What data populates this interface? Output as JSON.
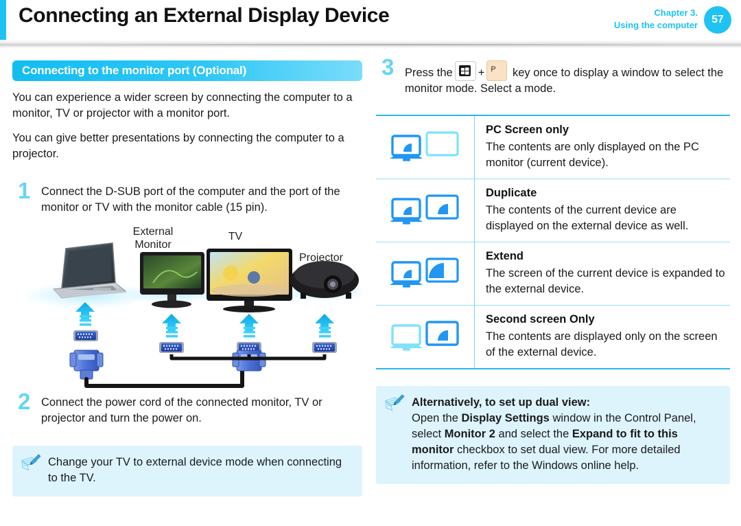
{
  "header": {
    "title": "Connecting an External Display Device",
    "chapter_line1": "Chapter 3.",
    "chapter_line2": "Using the computer",
    "page_number": "57",
    "accent_color": "#1ec2f3"
  },
  "left": {
    "section_title": "Connecting to the monitor port (Optional)",
    "paragraph1": "You can experience a wider screen by connecting the computer to a monitor, TV or projector with a monitor port.",
    "paragraph2": "You can give better presentations by connecting the computer to a projector.",
    "step1_number": "1",
    "step1_text": "Connect the D-SUB port of the computer and the port of the monitor or TV with the monitor cable (15 pin).",
    "step2_number": "2",
    "step2_text": "Connect the power cord of the connected monitor, TV or projector and turn the power on.",
    "note_text": "Change your TV to external device mode when connecting to the TV.",
    "diagram": {
      "label_external_monitor_line1": "External",
      "label_external_monitor_line2": "Monitor",
      "label_tv": "TV",
      "label_projector": "Projector"
    }
  },
  "right": {
    "step3_number": "3",
    "step3_text_before": "Press the",
    "key_windows": "windows-key-icon",
    "key_plus": "+",
    "key_p": "P",
    "step3_text_after": "key once to display a window to select the monitor mode. Select a mode.",
    "modes": [
      {
        "icon": "pc-screen-only-icon",
        "title": "PC Screen only",
        "desc": "The contents are only displayed on the PC monitor (current device)."
      },
      {
        "icon": "duplicate-icon",
        "title": "Duplicate",
        "desc": "The contents of the current device are displayed on the external device as well."
      },
      {
        "icon": "extend-icon",
        "title": "Extend",
        "desc": "The screen of the current device is expanded to the external device."
      },
      {
        "icon": "second-screen-only-icon",
        "title": "Second screen Only",
        "desc": "The contents are displayed only on the screen of the external device."
      }
    ],
    "note_title": "Alternatively, to set up dual view:",
    "note_body_1": "Open the ",
    "note_bold_1": "Display Settings",
    "note_body_2": " window in the Control Panel, select ",
    "note_bold_2": "Monitor 2",
    "note_body_3": " and select the ",
    "note_bold_3": "Expand to fit to this monitor",
    "note_body_4": " checkbox to set dual view. For more detailed information, refer to the Windows online help."
  },
  "colors": {
    "accent": "#1ec2f3",
    "note_background": "#ddf4fd",
    "step_number": "#66d4f7",
    "table_border": "#2ab6ee",
    "icon_active": "#2196f3",
    "icon_inactive": "#7fe2fb"
  }
}
